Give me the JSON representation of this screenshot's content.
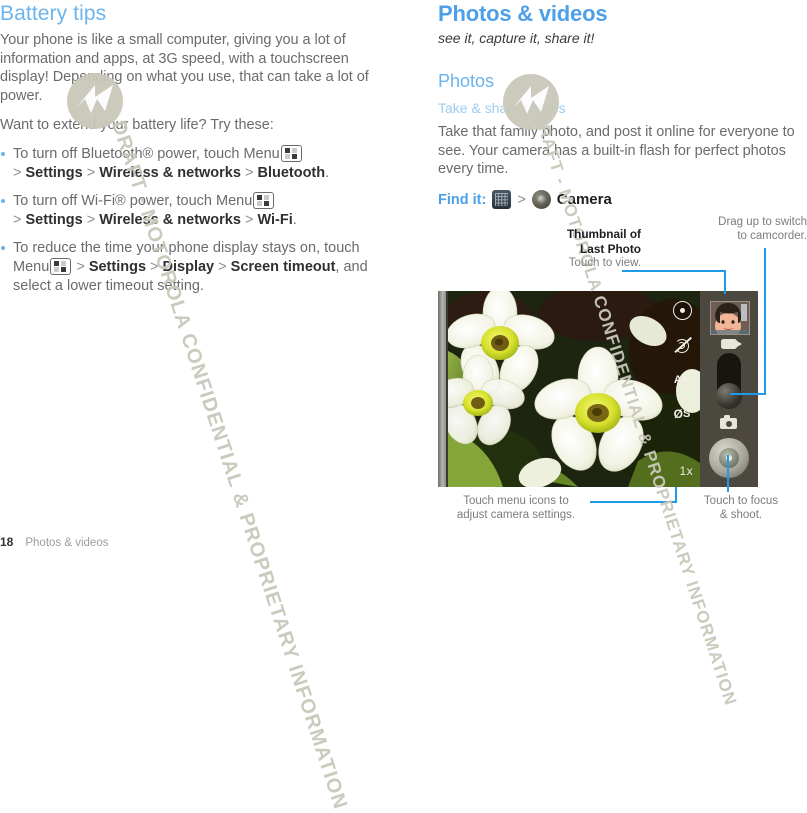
{
  "colors": {
    "heading_light_blue": "#6cb4ec",
    "heading_bold_blue": "#4d9fe8",
    "subsection_blue": "#9ccdf0",
    "body_gray": "#6a6b6d",
    "callout_line_blue": "#1e9ae6",
    "watermark_khaki": "#c9c8ba"
  },
  "watermark": {
    "text": "DRAFT - MOTOROLA CONFIDENTIAL & PROPRIETARY INFORMATION",
    "logo_name": "motorola-batwing-logo"
  },
  "left_column": {
    "heading": "Battery tips",
    "paragraph_1": "Your phone is like a small computer, giving you a lot of information and apps, at 3G speed, with a touchscreen display! Depending on what you use, that can take a lot of power.",
    "paragraph_2": "Want to extend your battery life? Try these:",
    "bullets": [
      {
        "lead": "To turn off Bluetooth® power, touch Menu",
        "icon": "menu-key-icon",
        "path": [
          ">",
          "Settings",
          ">",
          "Wireless & networks",
          ">",
          "Bluetooth"
        ],
        "trail": "."
      },
      {
        "lead": "To turn off Wi-Fi® power, touch Menu",
        "icon": "menu-key-icon",
        "path": [
          ">",
          "Settings",
          ">",
          "Wireless & networks",
          ">",
          "Wi-Fi"
        ],
        "trail": "."
      },
      {
        "lead": "To reduce the time your phone display stays on, touch Menu",
        "icon": "menu-key-icon",
        "path": [
          ">",
          "Settings",
          ">",
          "Display",
          ">",
          "Screen timeout"
        ],
        "trail": ", and select a lower timeout setting."
      }
    ]
  },
  "right_column": {
    "chapter_title": "Photos & videos",
    "chapter_subtitle": "see it, capture it, share it!",
    "section_title": "Photos",
    "subsection_title": "Take & share photos",
    "paragraph": "Take that family photo, and post it online for everyone to see. Your camera has a built-in flash for perfect photos every time.",
    "find_it": {
      "label": "Find it:",
      "launcher_icon": "app-launcher-icon",
      "separator": ">",
      "app_icon": "camera-app-icon",
      "app_name": "Camera"
    }
  },
  "callouts": {
    "thumbnail": {
      "title_line1": "Thumbnail of",
      "title_line2": "Last Photo",
      "subtitle": "Touch to view."
    },
    "camcorder": {
      "line1": "Drag up to switch",
      "line2": "to camcorder."
    },
    "menu_icons": {
      "line1": "Touch menu icons to",
      "line2": "adjust camera settings."
    },
    "shutter": {
      "line1": "Touch to focus",
      "line2": "& shoot."
    }
  },
  "viewfinder": {
    "icons": [
      {
        "name": "camera-settings-icon",
        "label": ""
      },
      {
        "name": "flash-off-icon",
        "label": ""
      },
      {
        "name": "auto-white-balance-icon",
        "label": "Aw"
      },
      {
        "name": "scene-mode-icon",
        "label": "S"
      }
    ],
    "zoom_level": "1x",
    "bar": {
      "video_mode_icon": "video-camera-icon",
      "photo_mode_icon": "still-camera-icon",
      "slider_handle": "mode-switch-knob",
      "shutter_button": "shutter-button",
      "thumbnail": "last-photo-thumbnail"
    }
  },
  "footer": {
    "page_number": "18",
    "chapter": "Photos & videos"
  }
}
